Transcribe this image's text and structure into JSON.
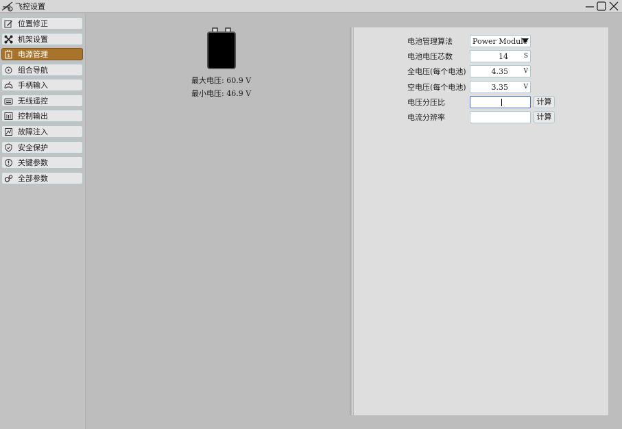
{
  "window": {
    "title": "飞控设置",
    "icons": {
      "app": "plane-wrench-icon",
      "minimize": "minimize-icon",
      "maximize": "maximize-icon",
      "close": "close-icon"
    }
  },
  "sidebar": {
    "active_index": 2,
    "accent": "#a8742c",
    "items": [
      {
        "label": "位置修正",
        "icon": "edit-icon"
      },
      {
        "label": "机架设置",
        "icon": "quadcopter-icon"
      },
      {
        "label": "电源管理",
        "icon": "battery-icon"
      },
      {
        "label": "组合导航",
        "icon": "compass-icon"
      },
      {
        "label": "手柄输入",
        "icon": "gamepad-icon"
      },
      {
        "label": "无线遥控",
        "icon": "remote-icon"
      },
      {
        "label": "控制输出",
        "icon": "output-icon"
      },
      {
        "label": "故障注入",
        "icon": "fault-icon"
      },
      {
        "label": "安全保护",
        "icon": "shield-icon"
      },
      {
        "label": "关键参数",
        "icon": "info-icon"
      },
      {
        "label": "全部参数",
        "icon": "gears-icon"
      }
    ]
  },
  "battery_panel": {
    "icon": "battery-large-icon",
    "max_voltage": "最大电压: 60.9 V",
    "min_voltage": "最小电压: 46.9 V"
  },
  "form": {
    "algorithm": {
      "label": "电池管理算法",
      "value": "Power Module"
    },
    "cells": {
      "label": "电池电压芯数",
      "value": "14",
      "unit": "S"
    },
    "full_voltage": {
      "label": "全电压(每个电池)",
      "value": "4.35",
      "unit": "V"
    },
    "empty_voltage": {
      "label": "空电压(每个电池)",
      "value": "3.35",
      "unit": "V"
    },
    "voltage_divider": {
      "label": "电压分压比",
      "value": "",
      "button": "计算"
    },
    "current_resolution": {
      "label": "电流分辨率",
      "value": "",
      "button": "计算"
    }
  }
}
